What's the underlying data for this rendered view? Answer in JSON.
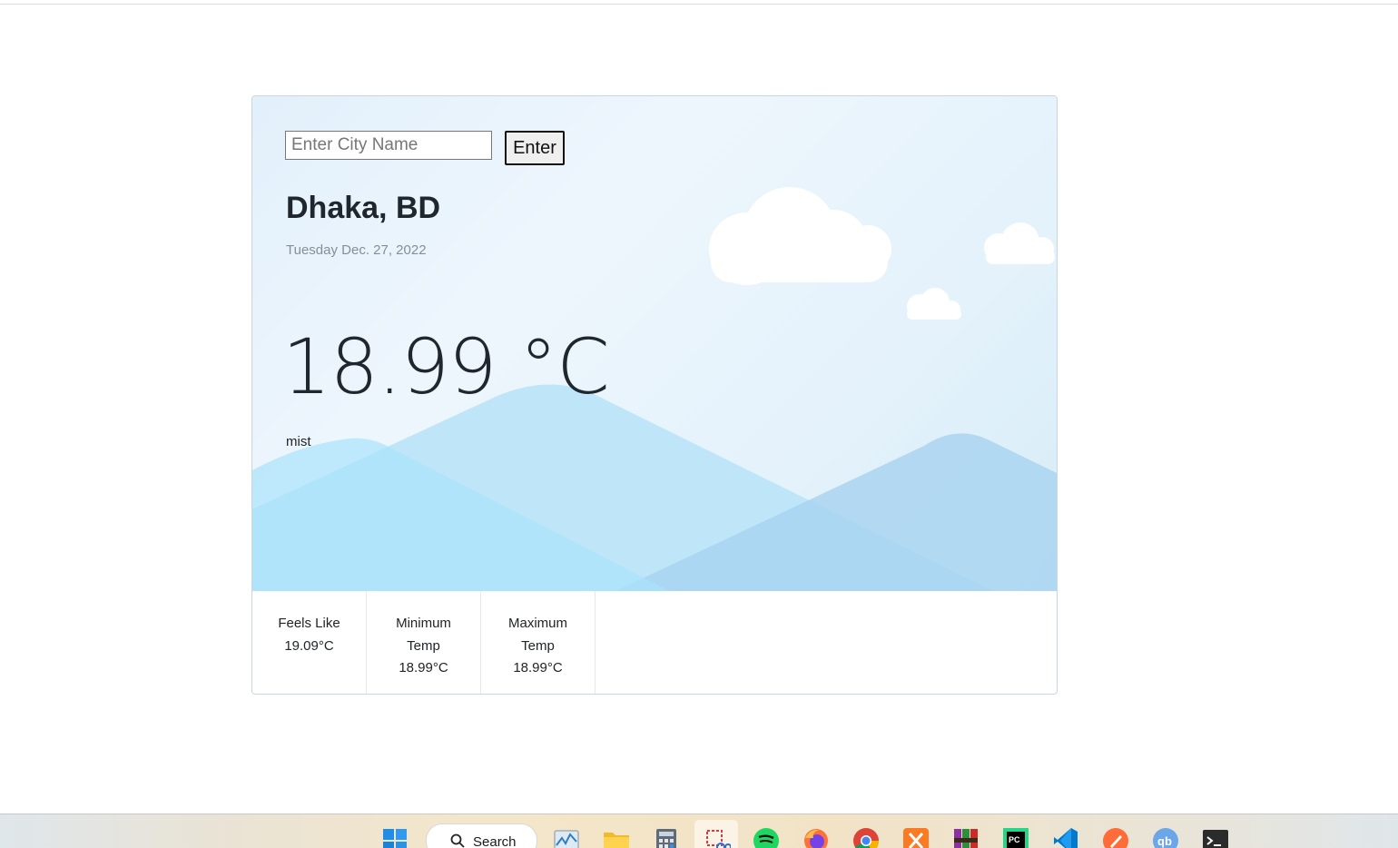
{
  "search": {
    "placeholder": "Enter City Name",
    "value": "",
    "button_label": "Enter"
  },
  "weather": {
    "location": "Dhaka, BD",
    "date": "Tuesday Dec. 27, 2022",
    "temperature": "18.99 °C",
    "description": "mist"
  },
  "stats": [
    {
      "label": "Feels Like",
      "value": "19.09°C"
    },
    {
      "label": "Minimum Temp",
      "value": "18.99°C"
    },
    {
      "label": "Maximum Temp",
      "value": "18.99°C"
    }
  ],
  "taskbar": {
    "search_label": "Search",
    "icons": [
      "windows-start-icon",
      "search-icon",
      "task-manager-icon",
      "file-explorer-icon",
      "calculator-icon",
      "snipping-tool-icon",
      "spotify-icon",
      "firefox-icon",
      "chrome-icon",
      "xampp-icon",
      "winrar-icon",
      "pycharm-icon",
      "vscode-icon",
      "postman-icon",
      "qbittorrent-icon",
      "terminal-icon"
    ]
  },
  "colors": {
    "sky_light": "#e2f0fb",
    "mountain_front": "#a9e3fb",
    "mountain_mid": "#bde5f8",
    "mountain_right": "#b7daf2",
    "cloud": "#ffffff"
  }
}
